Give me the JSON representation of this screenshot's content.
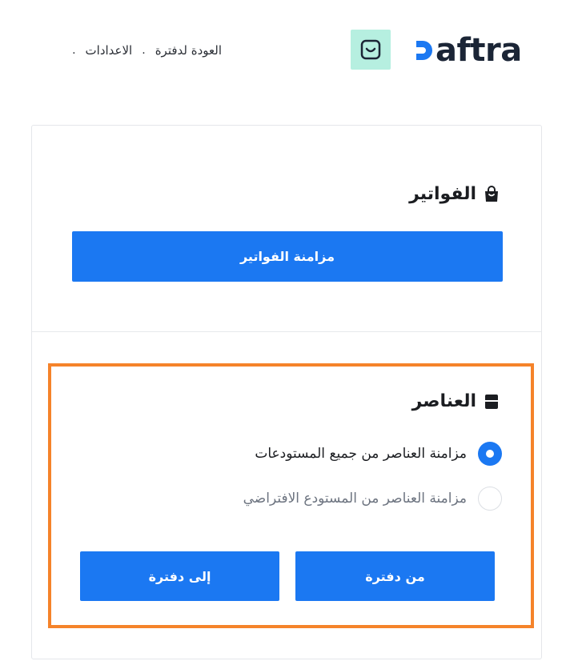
{
  "header": {
    "logo_text": "aftra",
    "logo_lettering": "Daftra",
    "app_icon": "smile-bag-icon",
    "nav": {
      "settings": "الاعدادات",
      "back": "العودة لدفترة",
      "separator": "."
    }
  },
  "invoices": {
    "title": "الفواتير",
    "icon": "shopping-bag-icon",
    "sync_button": "مزامنة الفواتير"
  },
  "items": {
    "title": "العناصر",
    "icon": "box-icon",
    "options": [
      {
        "label": "مزامنة العناصر من جميع المستودعات",
        "selected": true
      },
      {
        "label": "مزامنة العناصر من المستودع الافتراضي",
        "selected": false
      }
    ],
    "from_button": "من دفترة",
    "to_button": "إلى دفترة"
  },
  "colors": {
    "primary": "#1b78f2",
    "highlight": "#f5832a",
    "app_icon_bg": "#b6efe0",
    "logo_text": "#1b2536"
  }
}
